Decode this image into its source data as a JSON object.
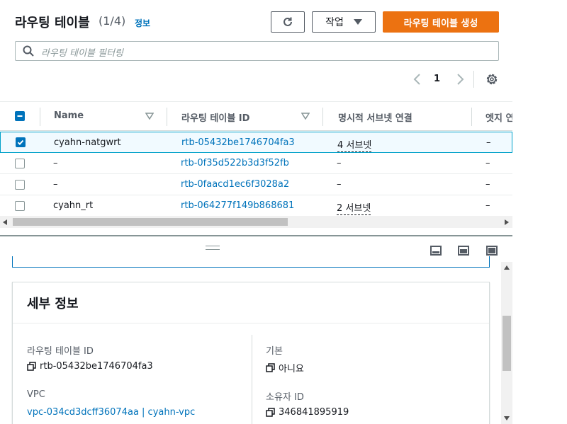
{
  "header": {
    "title": "라우팅 테이블",
    "count": "(1/4)",
    "info": "정보",
    "actions_label": "작업",
    "create_label": "라우팅 테이블 생성"
  },
  "search": {
    "placeholder": "라우팅 테이블 필터링"
  },
  "pagination": {
    "page": "1"
  },
  "columns": [
    "Name",
    "라우팅 테이블 ID",
    "명시적 서브넷 연결",
    "엣지 연"
  ],
  "rows": [
    {
      "name": "cyahn-natgwrt",
      "id": "rtb-05432be1746704fa3",
      "subnets": "4 서브넷",
      "edge": "–",
      "selected": true
    },
    {
      "name": "–",
      "id": "rtb-0f35d522b3d3f52fb",
      "subnets": "–",
      "edge": "–",
      "selected": false
    },
    {
      "name": "–",
      "id": "rtb-0faacd1ec6f3028a2",
      "subnets": "–",
      "edge": "–",
      "selected": false
    },
    {
      "name": "cyahn_rt",
      "id": "rtb-064277f149b868681",
      "subnets": "2 서브넷",
      "edge": "–",
      "selected": false
    }
  ],
  "details": {
    "title": "세부 정보",
    "rtb_label": "라우팅 테이블 ID",
    "rtb_value": "rtb-05432be1746704fa3",
    "main_label": "기본",
    "main_value": "아니요",
    "vpc_label": "VPC",
    "vpc_value": "vpc-034cd3dcff36074aa | cyahn-vpc",
    "owner_label": "소유자 ID",
    "owner_value": "346841895919"
  },
  "colors": {
    "primary": "#ec7211",
    "link": "#0073bb",
    "selected_row": "#f1faff"
  }
}
